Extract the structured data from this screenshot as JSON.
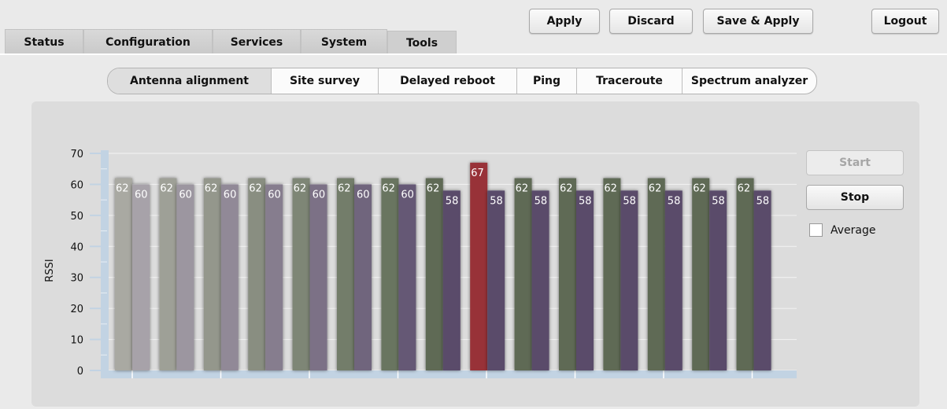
{
  "main_tabs": [
    {
      "label": "Status",
      "active": false
    },
    {
      "label": "Configuration",
      "active": false
    },
    {
      "label": "Services",
      "active": false
    },
    {
      "label": "System",
      "active": false
    },
    {
      "label": "Tools",
      "active": true
    }
  ],
  "actions": {
    "apply": "Apply",
    "discard": "Discard",
    "save_apply": "Save & Apply",
    "logout": "Logout"
  },
  "sub_tabs": [
    {
      "label": "Antenna alignment",
      "active": true
    },
    {
      "label": "Site survey",
      "active": false
    },
    {
      "label": "Delayed reboot",
      "active": false
    },
    {
      "label": "Ping",
      "active": false
    },
    {
      "label": "Traceroute",
      "active": false
    },
    {
      "label": "Spectrum analyzer",
      "active": false
    }
  ],
  "controls": {
    "start": "Start",
    "start_enabled": false,
    "stop": "Stop",
    "average": "Average",
    "average_checked": false
  },
  "chart_data": {
    "type": "bar",
    "ylabel": "RSSI",
    "ylim": [
      0,
      70
    ],
    "yticks": [
      0,
      10,
      20,
      30,
      40,
      50,
      60,
      70
    ],
    "series": [
      {
        "values": [
          62,
          62,
          62,
          62,
          62,
          62,
          62,
          62,
          67,
          62,
          62,
          62,
          62,
          62,
          62
        ]
      },
      {
        "values": [
          60,
          60,
          60,
          60,
          60,
          60,
          60,
          58,
          58,
          58,
          58,
          58,
          58,
          58,
          58
        ]
      }
    ],
    "highlight_index": 8,
    "colors": {
      "series1_fade": "#a9a9a2",
      "series1_recent": "#5e6b55",
      "series2_fade": "#a7a2a9",
      "series2_recent": "#5a4c6b",
      "highlight": "#983238",
      "axis": "#c2d3e3"
    }
  }
}
